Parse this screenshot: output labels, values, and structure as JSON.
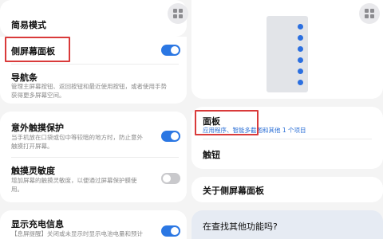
{
  "left": {
    "simple_mode": {
      "title": "简易模式"
    },
    "edge_panels": {
      "title": "侧屏幕面板",
      "enabled": true
    },
    "nav_bar": {
      "title": "导航条",
      "desc1": "管理主屏幕按钮、返回按钮和最近使用按钮，或者使用手势",
      "desc2": "获得更多屏幕空间。"
    },
    "accidental_touch": {
      "title": "意外触摸保护",
      "desc1": "当手机放在口袋或包中等较暗的地方时，防止意外",
      "desc2": "触摸打开屏幕。",
      "enabled": true
    },
    "touch_sensitivity": {
      "title": "触摸灵敏度",
      "desc1": "增加屏幕的触摸灵敏度，以便通过屏幕保护膜使",
      "desc2": "用。",
      "enabled": false
    },
    "charging_info": {
      "title": "显示充电信息",
      "desc1": "【息屏提醒】关闭或未显示时显示电池电量和预计",
      "enabled": true
    }
  },
  "right": {
    "panels": {
      "title": "面板",
      "subtitle": "应用程序、智能多截图和其他 1 个项目"
    },
    "handle": {
      "title": "触钮"
    },
    "about": {
      "title": "关于侧屏幕面板"
    },
    "looking": {
      "title": "在查找其他功能吗?"
    }
  },
  "colors": {
    "accent": "#2b77e3",
    "highlight": "#d93a3a",
    "toggle_off": "#c9c9cc"
  },
  "icons": {
    "grid": "grid-icon",
    "panel_dots": "panel-handle-dots"
  }
}
